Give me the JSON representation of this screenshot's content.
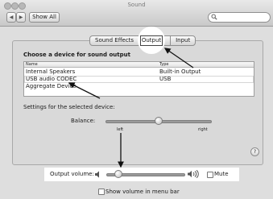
{
  "window": {
    "title": "Sound"
  },
  "toolbar": {
    "back_glyph": "◀",
    "forward_glyph": "▶",
    "show_all_label": "Show All",
    "search_placeholder": ""
  },
  "tabs": [
    {
      "label": "Sound Effects",
      "selected": false
    },
    {
      "label": "Output",
      "selected": true
    },
    {
      "label": "Input",
      "selected": false
    }
  ],
  "device_section": {
    "heading": "Choose a device for sound output",
    "columns": [
      "Name",
      "Type"
    ],
    "rows": [
      {
        "name": "Internal Speakers",
        "type": "Built-in Output",
        "selected": false
      },
      {
        "name": "USB audio CODEC",
        "type": "USB",
        "selected": true
      },
      {
        "name": "Aggregate Device",
        "type": "",
        "selected": false
      }
    ]
  },
  "settings": {
    "label": "Settings for the selected device:",
    "balance_label": "Balance:",
    "balance_left": "left",
    "balance_right": "right",
    "balance_value": 0.5
  },
  "help_glyph": "?",
  "output_volume": {
    "label": "Output volume:",
    "value": 0.15,
    "mute_label": "Mute",
    "muted": false
  },
  "menu_bar_option": {
    "label": "Show volume in menu bar",
    "checked": false
  },
  "icons": {
    "speaker_low": "speaker-low-icon",
    "speaker_high": "speaker-high-icon",
    "search": "magnifier-icon"
  },
  "colors": {
    "window_bg": "#dedede",
    "annotation": "#111111",
    "highlight": "#ffffff"
  }
}
